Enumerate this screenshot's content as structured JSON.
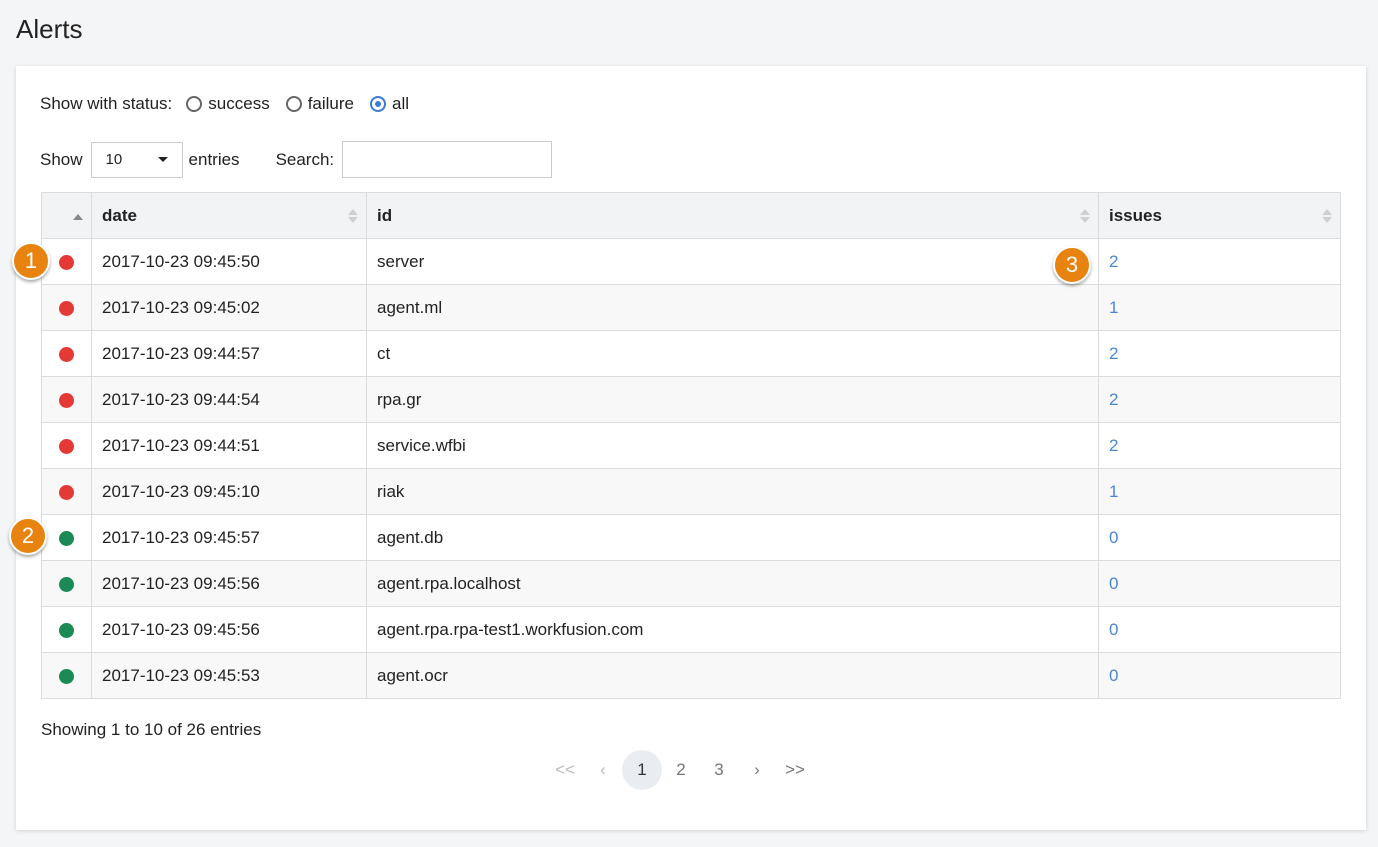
{
  "title": "Alerts",
  "filters": {
    "label": "Show with status:",
    "options": [
      {
        "label": "success",
        "checked": false
      },
      {
        "label": "failure",
        "checked": false
      },
      {
        "label": "all",
        "checked": true
      }
    ]
  },
  "length": {
    "show_label": "Show",
    "value": "10",
    "entries_label": "entries"
  },
  "search": {
    "label": "Search:",
    "value": ""
  },
  "table": {
    "headers": [
      "date",
      "id",
      "issues"
    ],
    "rows": [
      {
        "status_color": "#e53935",
        "date": "2017-10-23 09:45:50",
        "id": "server",
        "issues": "2"
      },
      {
        "status_color": "#e53935",
        "date": "2017-10-23 09:45:02",
        "id": "agent.ml",
        "issues": "1"
      },
      {
        "status_color": "#e53935",
        "date": "2017-10-23 09:44:57",
        "id": "ct",
        "issues": "2"
      },
      {
        "status_color": "#e53935",
        "date": "2017-10-23 09:44:54",
        "id": "rpa.gr",
        "issues": "2"
      },
      {
        "status_color": "#e53935",
        "date": "2017-10-23 09:44:51",
        "id": "service.wfbi",
        "issues": "2"
      },
      {
        "status_color": "#e53935",
        "date": "2017-10-23 09:45:10",
        "id": "riak",
        "issues": "1"
      },
      {
        "status_color": "#1b8a55",
        "date": "2017-10-23 09:45:57",
        "id": "agent.db",
        "issues": "0"
      },
      {
        "status_color": "#1b8a55",
        "date": "2017-10-23 09:45:56",
        "id": "agent.rpa.localhost",
        "issues": "0"
      },
      {
        "status_color": "#1b8a55",
        "date": "2017-10-23 09:45:56",
        "id": "agent.rpa.rpa-test1.workfusion.com",
        "issues": "0"
      },
      {
        "status_color": "#1b8a55",
        "date": "2017-10-23 09:45:53",
        "id": "agent.ocr",
        "issues": "0"
      }
    ]
  },
  "info": "Showing 1 to 10 of 26 entries",
  "pagination": {
    "first": "<<",
    "prev": "‹",
    "pages": [
      "1",
      "2",
      "3"
    ],
    "active": "1",
    "next": "›",
    "last": ">>"
  },
  "callouts": [
    "1",
    "2",
    "3"
  ]
}
